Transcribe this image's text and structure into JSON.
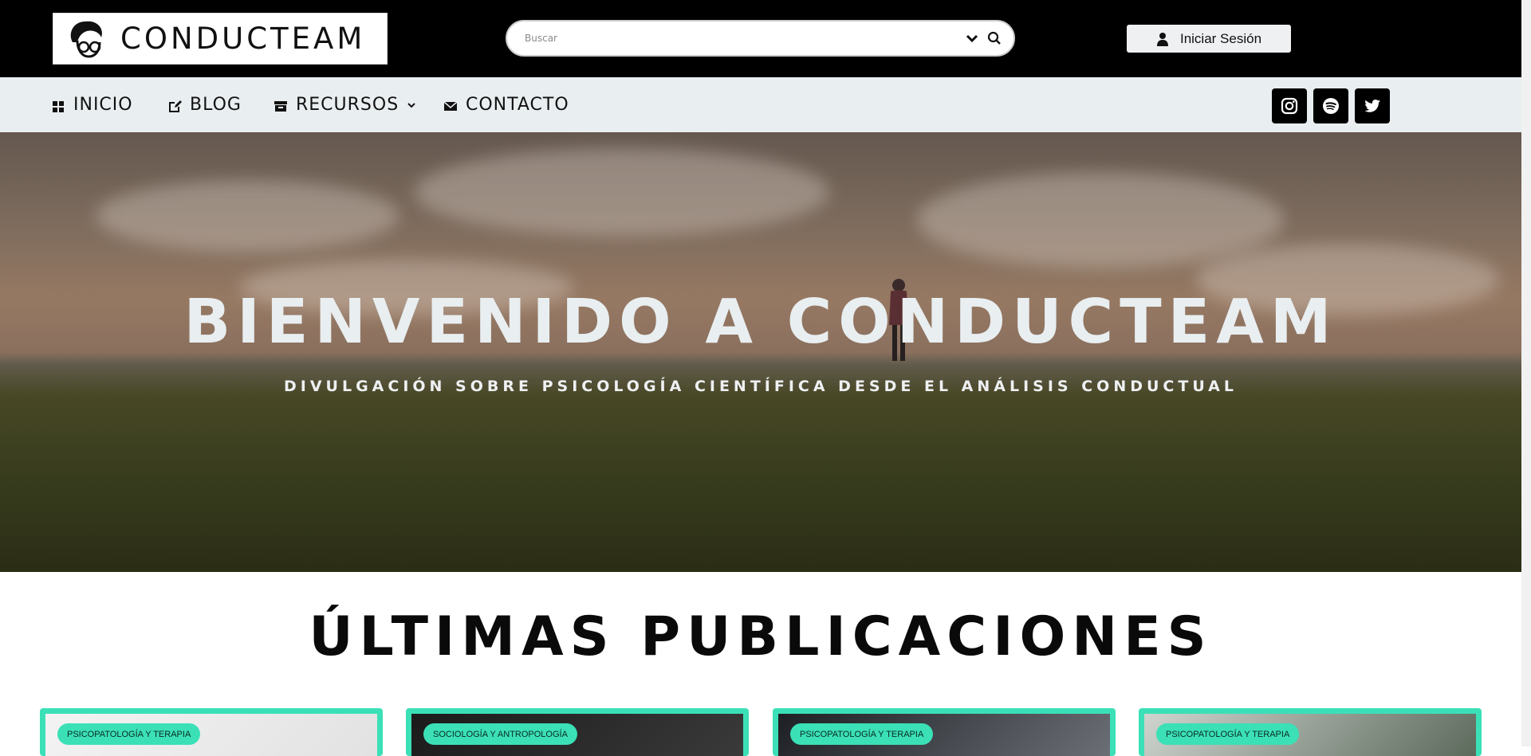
{
  "header": {
    "logo_text": "CONDUCTEAM",
    "search_placeholder": "Buscar",
    "login_label": "Iniciar Sesión"
  },
  "nav": {
    "items": [
      {
        "label": "INICIO",
        "icon": "grid-icon"
      },
      {
        "label": "BLOG",
        "icon": "edit-icon"
      },
      {
        "label": "RECURSOS",
        "icon": "archive-icon"
      },
      {
        "label": "CONTACTO",
        "icon": "envelope-icon"
      }
    ],
    "social": [
      "instagram-icon",
      "spotify-icon",
      "twitter-icon"
    ]
  },
  "hero": {
    "title": "BIENVENIDO A CONDUCTEAM",
    "subtitle": "DIVULGACIÓN SOBRE PSICOLOGÍA CIENTÍFICA DESDE EL ANÁLISIS CONDUCTUAL"
  },
  "section": {
    "title": "ÚLTIMAS PUBLICACIONES"
  },
  "cards": [
    {
      "tag": "PSICOPATOLOGÍA Y TERAPIA"
    },
    {
      "tag": "SOCIOLOGÍA Y ANTROPOLOGÍA"
    },
    {
      "tag": "PSICOPATOLOGÍA Y TERAPIA"
    },
    {
      "tag": "PSICOPATOLOGÍA Y TERAPIA"
    }
  ],
  "colors": {
    "accent": "#3be0b7",
    "topbar": "#000000",
    "navbar": "#e9eef0"
  }
}
